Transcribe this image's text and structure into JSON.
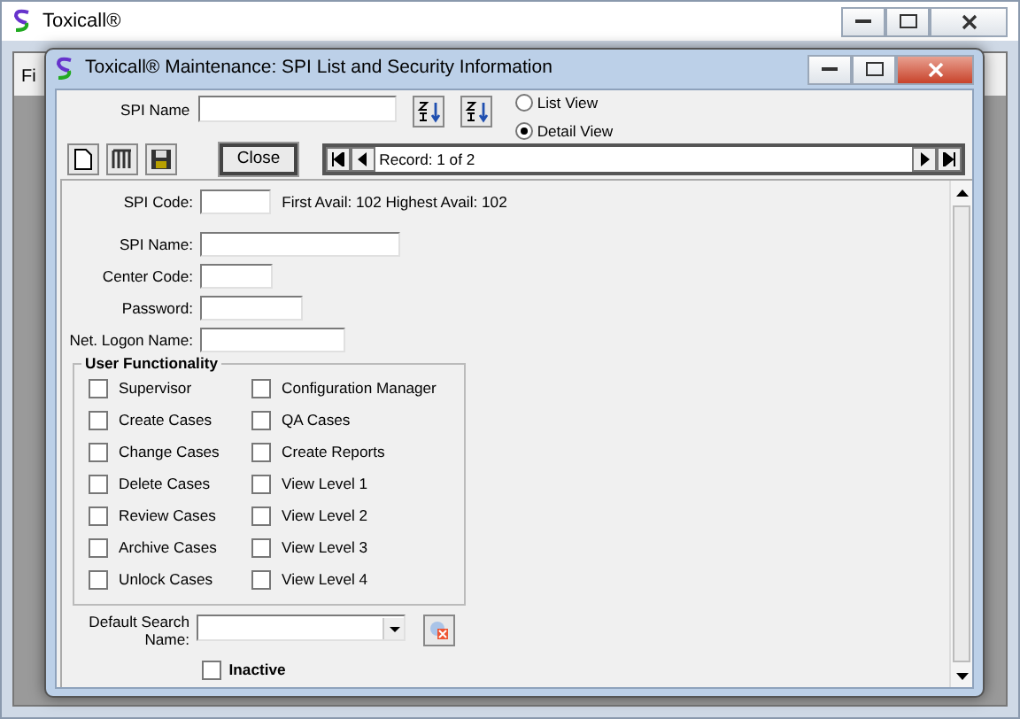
{
  "app": {
    "title": "Toxicall®",
    "menu": [
      "Fi"
    ]
  },
  "dialog": {
    "title": "Toxicall® Maintenance: SPI List and Security Information",
    "search_label": "SPI Name",
    "views": [
      {
        "label": "List View",
        "selected": false
      },
      {
        "label": "Detail View",
        "selected": true
      }
    ],
    "close_button": "Close",
    "record": "Record: 1 of 2",
    "fields": [
      {
        "label": "SPI Code:",
        "note": "First Avail: 102 Highest Avail: 102"
      },
      {
        "label": "SPI Name:"
      },
      {
        "label": "Center Code:"
      },
      {
        "label": "Password:"
      },
      {
        "label": "Net. Logon Name:"
      }
    ],
    "functionality": {
      "title": "User Functionality",
      "columns": [
        [
          {
            "label": "Supervisor",
            "checked": false
          },
          {
            "label": "Create Cases",
            "checked": false
          },
          {
            "label": "Change Cases",
            "checked": false
          },
          {
            "label": "Delete Cases",
            "checked": false
          },
          {
            "label": "Review Cases",
            "checked": false
          },
          {
            "label": "Archive Cases",
            "checked": false
          },
          {
            "label": "Unlock Cases",
            "checked": false
          }
        ],
        [
          {
            "label": "Configuration Manager",
            "checked": false
          },
          {
            "label": "QA Cases",
            "checked": false
          },
          {
            "label": "Create Reports",
            "checked": false
          },
          {
            "label": "View Level 1",
            "checked": false
          },
          {
            "label": "View Level 2",
            "checked": false
          },
          {
            "label": "View Level 3",
            "checked": false
          },
          {
            "label": "View Level 4",
            "checked": false
          }
        ]
      ]
    },
    "default_search_label": "Default Search Name:",
    "inactive": {
      "label": "Inactive",
      "checked": false
    }
  }
}
